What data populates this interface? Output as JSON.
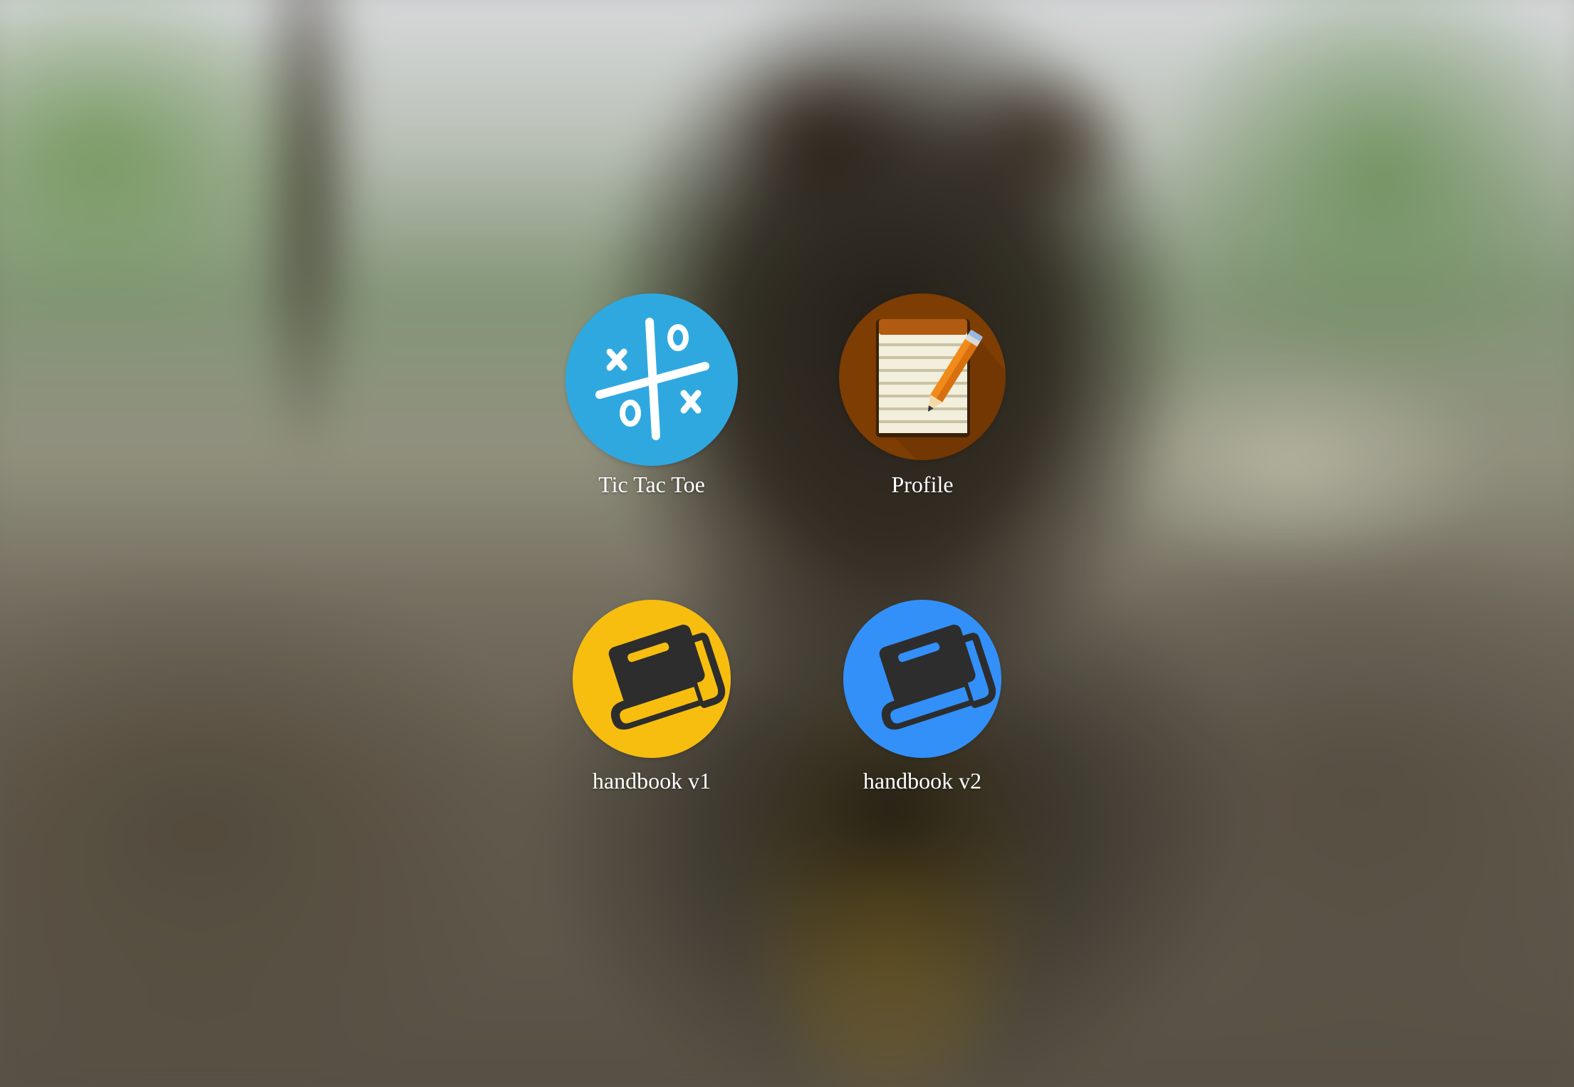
{
  "desktop": {
    "wallpaper": "blurred-quokka-photo",
    "apps": [
      {
        "label": "Tic Tac Toe",
        "icon": "tic-tac-toe-icon",
        "color": "#2fa8e0"
      },
      {
        "label": "Profile",
        "icon": "notepad-pencil-icon",
        "color": "#7d3d03"
      },
      {
        "label": "handbook v1",
        "icon": "book-icon",
        "color": "#f7be10"
      },
      {
        "label": "handbook v2",
        "icon": "book-icon",
        "color": "#3390f8"
      }
    ]
  }
}
